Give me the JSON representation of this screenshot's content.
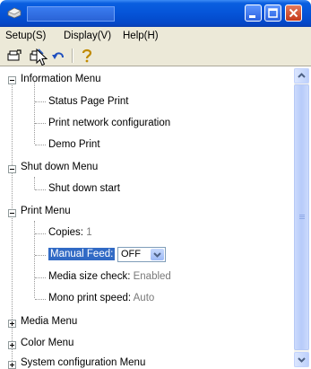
{
  "window": {
    "title": ""
  },
  "menubar": {
    "items": [
      {
        "label": "Setup(S)"
      },
      {
        "label": "Display(V)"
      },
      {
        "label": "Help(H)"
      }
    ]
  },
  "toolbar": {
    "buttons": [
      {
        "icon": "printer-settings-icon"
      },
      {
        "icon": "printer-edit-icon"
      },
      {
        "icon": "undo-icon"
      },
      {
        "icon": "help-icon"
      }
    ]
  },
  "tree": {
    "information_menu": {
      "label": "Information Menu",
      "children": [
        "Status Page Print",
        "Print network configuration",
        "Demo Print"
      ]
    },
    "shutdown_menu": {
      "label": "Shut down Menu",
      "children": [
        "Shut down start"
      ]
    },
    "print_menu": {
      "label": "Print Menu",
      "copies": {
        "label": "Copies:",
        "value": "1"
      },
      "manual_feed": {
        "label": "Manual Feed:",
        "value": "OFF"
      },
      "media_size_check": {
        "label": "Media size check:",
        "value": "Enabled"
      },
      "mono_print_speed": {
        "label": "Mono print speed:",
        "value": "Auto"
      }
    },
    "collapsed": [
      "Media Menu",
      "Color Menu",
      "System configuration Menu"
    ]
  },
  "colors": {
    "titlebar": "#0554d8",
    "selection": "#316ac5",
    "chrome": "#ece9d8"
  }
}
